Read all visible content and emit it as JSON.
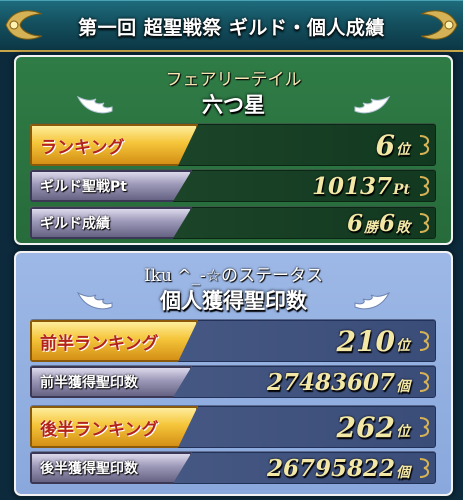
{
  "header": {
    "title": "第一回 超聖戦祭 ギルド・個人成績"
  },
  "guild": {
    "name": "フェアリーテイル",
    "rank_title": "六つ星",
    "rows": [
      {
        "label": "ランキング",
        "value": "6",
        "unit": "位"
      },
      {
        "label": "ギルド聖戦Pt",
        "value": "10137",
        "unit": "Pt"
      },
      {
        "label": "ギルド成績",
        "wins": "6",
        "wins_unit": "勝",
        "losses": "6",
        "losses_unit": "敗"
      }
    ]
  },
  "personal": {
    "status_title": "Iku ^_-☆のステータス",
    "section_title": "個人獲得聖印数",
    "rows": [
      {
        "label": "前半ランキング",
        "value": "210",
        "unit": "位"
      },
      {
        "label": "前半獲得聖印数",
        "value": "27483607",
        "unit": "個"
      },
      {
        "label": "後半ランキング",
        "value": "262",
        "unit": "位"
      },
      {
        "label": "後半獲得聖印数",
        "value": "26795822",
        "unit": "個"
      }
    ]
  },
  "colors": {
    "guild_panel": "#2f7c46",
    "personal_panel": "#9db8e6",
    "gold_tab": "#f5c53a",
    "silver_tab": "#9c98b8",
    "value_text": "#f3e7a6"
  },
  "icons": {
    "header_ornament": "gold-scroll-ornament-icon",
    "wing": "angel-wing-icon",
    "row_corner": "gold-corner-flourish-icon"
  }
}
